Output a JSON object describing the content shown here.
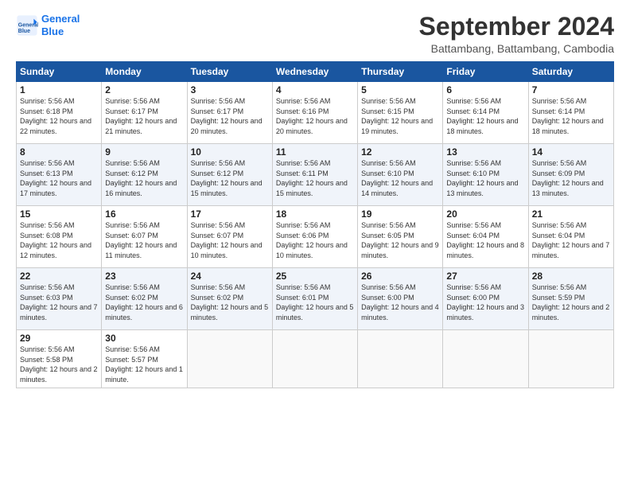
{
  "logo": {
    "line1": "General",
    "line2": "Blue"
  },
  "title": "September 2024",
  "subtitle": "Battambang, Battambang, Cambodia",
  "days_header": [
    "Sunday",
    "Monday",
    "Tuesday",
    "Wednesday",
    "Thursday",
    "Friday",
    "Saturday"
  ],
  "weeks": [
    [
      {
        "day": "1",
        "sunrise": "5:56 AM",
        "sunset": "6:18 PM",
        "daylight": "12 hours and 22 minutes."
      },
      {
        "day": "2",
        "sunrise": "5:56 AM",
        "sunset": "6:17 PM",
        "daylight": "12 hours and 21 minutes."
      },
      {
        "day": "3",
        "sunrise": "5:56 AM",
        "sunset": "6:17 PM",
        "daylight": "12 hours and 20 minutes."
      },
      {
        "day": "4",
        "sunrise": "5:56 AM",
        "sunset": "6:16 PM",
        "daylight": "12 hours and 20 minutes."
      },
      {
        "day": "5",
        "sunrise": "5:56 AM",
        "sunset": "6:15 PM",
        "daylight": "12 hours and 19 minutes."
      },
      {
        "day": "6",
        "sunrise": "5:56 AM",
        "sunset": "6:14 PM",
        "daylight": "12 hours and 18 minutes."
      },
      {
        "day": "7",
        "sunrise": "5:56 AM",
        "sunset": "6:14 PM",
        "daylight": "12 hours and 18 minutes."
      }
    ],
    [
      {
        "day": "8",
        "sunrise": "5:56 AM",
        "sunset": "6:13 PM",
        "daylight": "12 hours and 17 minutes."
      },
      {
        "day": "9",
        "sunrise": "5:56 AM",
        "sunset": "6:12 PM",
        "daylight": "12 hours and 16 minutes."
      },
      {
        "day": "10",
        "sunrise": "5:56 AM",
        "sunset": "6:12 PM",
        "daylight": "12 hours and 15 minutes."
      },
      {
        "day": "11",
        "sunrise": "5:56 AM",
        "sunset": "6:11 PM",
        "daylight": "12 hours and 15 minutes."
      },
      {
        "day": "12",
        "sunrise": "5:56 AM",
        "sunset": "6:10 PM",
        "daylight": "12 hours and 14 minutes."
      },
      {
        "day": "13",
        "sunrise": "5:56 AM",
        "sunset": "6:10 PM",
        "daylight": "12 hours and 13 minutes."
      },
      {
        "day": "14",
        "sunrise": "5:56 AM",
        "sunset": "6:09 PM",
        "daylight": "12 hours and 13 minutes."
      }
    ],
    [
      {
        "day": "15",
        "sunrise": "5:56 AM",
        "sunset": "6:08 PM",
        "daylight": "12 hours and 12 minutes."
      },
      {
        "day": "16",
        "sunrise": "5:56 AM",
        "sunset": "6:07 PM",
        "daylight": "12 hours and 11 minutes."
      },
      {
        "day": "17",
        "sunrise": "5:56 AM",
        "sunset": "6:07 PM",
        "daylight": "12 hours and 10 minutes."
      },
      {
        "day": "18",
        "sunrise": "5:56 AM",
        "sunset": "6:06 PM",
        "daylight": "12 hours and 10 minutes."
      },
      {
        "day": "19",
        "sunrise": "5:56 AM",
        "sunset": "6:05 PM",
        "daylight": "12 hours and 9 minutes."
      },
      {
        "day": "20",
        "sunrise": "5:56 AM",
        "sunset": "6:04 PM",
        "daylight": "12 hours and 8 minutes."
      },
      {
        "day": "21",
        "sunrise": "5:56 AM",
        "sunset": "6:04 PM",
        "daylight": "12 hours and 7 minutes."
      }
    ],
    [
      {
        "day": "22",
        "sunrise": "5:56 AM",
        "sunset": "6:03 PM",
        "daylight": "12 hours and 7 minutes."
      },
      {
        "day": "23",
        "sunrise": "5:56 AM",
        "sunset": "6:02 PM",
        "daylight": "12 hours and 6 minutes."
      },
      {
        "day": "24",
        "sunrise": "5:56 AM",
        "sunset": "6:02 PM",
        "daylight": "12 hours and 5 minutes."
      },
      {
        "day": "25",
        "sunrise": "5:56 AM",
        "sunset": "6:01 PM",
        "daylight": "12 hours and 5 minutes."
      },
      {
        "day": "26",
        "sunrise": "5:56 AM",
        "sunset": "6:00 PM",
        "daylight": "12 hours and 4 minutes."
      },
      {
        "day": "27",
        "sunrise": "5:56 AM",
        "sunset": "6:00 PM",
        "daylight": "12 hours and 3 minutes."
      },
      {
        "day": "28",
        "sunrise": "5:56 AM",
        "sunset": "5:59 PM",
        "daylight": "12 hours and 2 minutes."
      }
    ],
    [
      {
        "day": "29",
        "sunrise": "5:56 AM",
        "sunset": "5:58 PM",
        "daylight": "12 hours and 2 minutes."
      },
      {
        "day": "30",
        "sunrise": "5:56 AM",
        "sunset": "5:57 PM",
        "daylight": "12 hours and 1 minute."
      },
      null,
      null,
      null,
      null,
      null
    ]
  ]
}
